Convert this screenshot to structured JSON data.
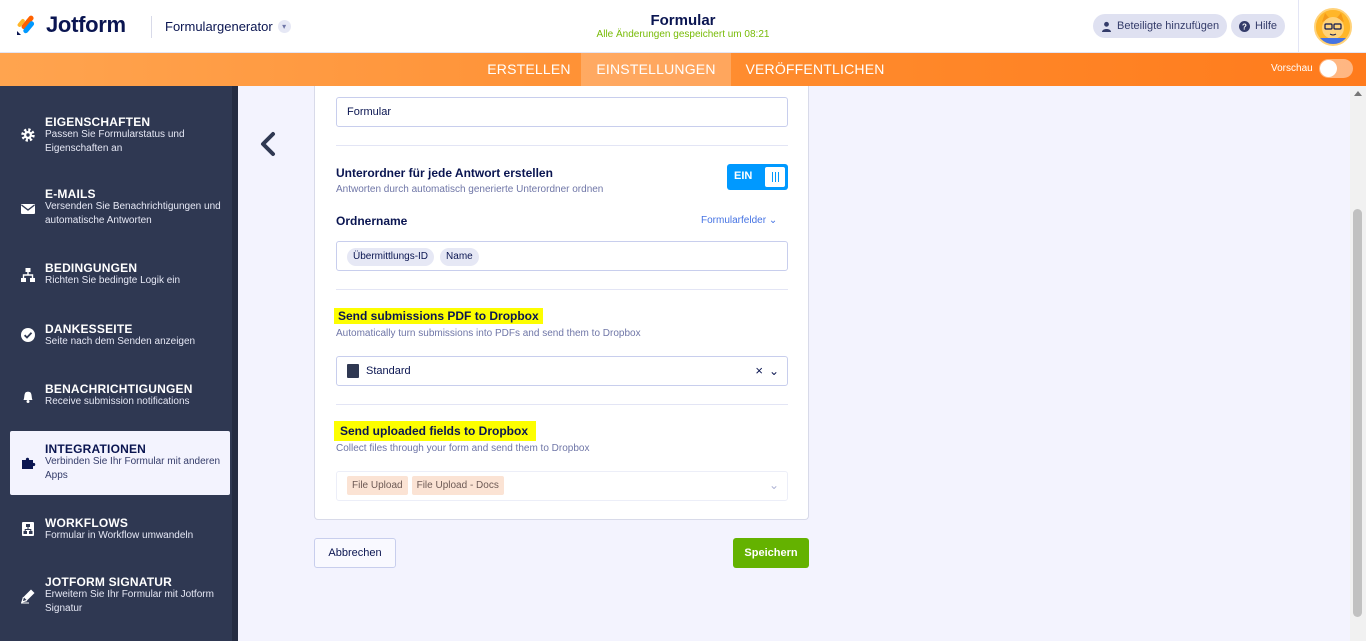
{
  "header": {
    "logo_text": "Jotform",
    "builder_label": "Formulargenerator",
    "form_title": "Formular",
    "save_status": "Alle Änderungen gespeichert um 08:21",
    "invite_label": "Beteiligte hinzufügen",
    "help_label": "Hilfe"
  },
  "nav": {
    "tabs": [
      "ERSTELLEN",
      "EINSTELLUNGEN",
      "VERÖFFENTLICHEN"
    ],
    "active_tab": "EINSTELLUNGEN",
    "preview_label": "Vorschau",
    "preview_on": false
  },
  "sidebar": {
    "items": [
      {
        "icon": "gear-icon",
        "title": "EIGENSCHAFTEN",
        "desc": "Passen Sie Formularstatus und Eigenschaften an"
      },
      {
        "icon": "envelope-icon",
        "title": "E-MAILS",
        "desc": "Versenden Sie Benachrichtigungen und automatische Antworten"
      },
      {
        "icon": "sitemap-icon",
        "title": "BEDINGUNGEN",
        "desc": "Richten Sie bedingte Logik ein"
      },
      {
        "icon": "check-circle-icon",
        "title": "DANKESSEITE",
        "desc": "Seite nach dem Senden anzeigen"
      },
      {
        "icon": "bell-icon",
        "title": "BENACHRICHTIGUNGEN",
        "desc": "Receive submission notifications"
      },
      {
        "icon": "puzzle-icon",
        "title": "INTEGRATIONEN",
        "desc": "Verbinden Sie Ihr Formular mit anderen Apps"
      },
      {
        "icon": "workflow-icon",
        "title": "WORKFLOWS",
        "desc": "Formular in Workflow umwandeln"
      },
      {
        "icon": "signature-pen-icon",
        "title": "JOTFORM SIGNATUR",
        "desc": "Erweitern Sie Ihr Formular mit Jotform Signatur"
      }
    ],
    "active": "INTEGRATIONEN"
  },
  "main": {
    "folder_input_value": "Formular",
    "subfolder": {
      "label": "Unterordner für jede Antwort erstellen",
      "desc": "Antworten durch automatisch generierte Unterordner ordnen",
      "toggle_label": "EIN"
    },
    "folder_name": {
      "label": "Ordnername",
      "fields_link": "Formularfelder",
      "tags": [
        "Übermittlungs-ID",
        "Name"
      ]
    },
    "pdf_section": {
      "label": "Send submissions PDF to Dropbox",
      "desc": "Automatically turn submissions into PDFs and send them to Dropbox",
      "select_value": "Standard"
    },
    "upload_section": {
      "label": "Send uploaded fields to Dropbox",
      "desc": "Collect files through your form and send them to Dropbox",
      "tags": [
        "File Upload",
        "File Upload - Docs"
      ]
    },
    "cancel_label": "Abbrechen",
    "save_label": "Speichern"
  },
  "colors": {
    "nav_orange": "#ff8a2c",
    "sidebar_bg": "#2f3852",
    "toggle_blue": "#0099ff",
    "save_green": "#64b200",
    "highlight": "#fdfe00"
  }
}
